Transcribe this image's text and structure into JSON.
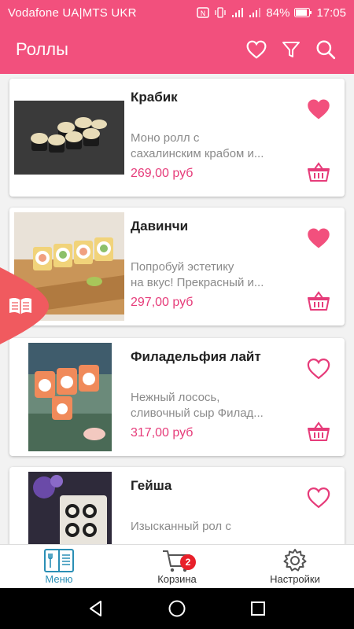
{
  "status_bar": {
    "carrier": "Vodafone UA|MTS UKR",
    "battery": "84%",
    "time": "17:05"
  },
  "app_bar": {
    "title": "Роллы",
    "icons": [
      "heart-outline-icon",
      "filter-icon",
      "search-icon"
    ]
  },
  "colors": {
    "primary": "#f2507d",
    "price": "#e63c7a",
    "heart": "#f2507d",
    "nav_active": "#2a8fb5",
    "badge": "#e8202a"
  },
  "products": [
    {
      "name": "Крабик",
      "desc_line1": "Моно ролл с",
      "desc_line2": "сахалинским крабом и...",
      "price": "269,00 руб",
      "favorite": true
    },
    {
      "name": "Давинчи",
      "desc_line1": "Попробуй эстетику",
      "desc_line2": "на вкус! Прекрасный и...",
      "price": "297,00 руб",
      "favorite": true
    },
    {
      "name": "Филадельфия лайт",
      "desc_line1": "Нежный лосось,",
      "desc_line2": "сливочный сыр Филад...",
      "price": "317,00 руб",
      "favorite": false
    },
    {
      "name": "Гейша",
      "desc_line1": "Изысканный рол с",
      "desc_line2": "",
      "price": "",
      "favorite": false
    }
  ],
  "bottom_nav": {
    "menu": "Меню",
    "cart": "Корзина",
    "cart_badge": "2",
    "settings": "Настройки"
  }
}
